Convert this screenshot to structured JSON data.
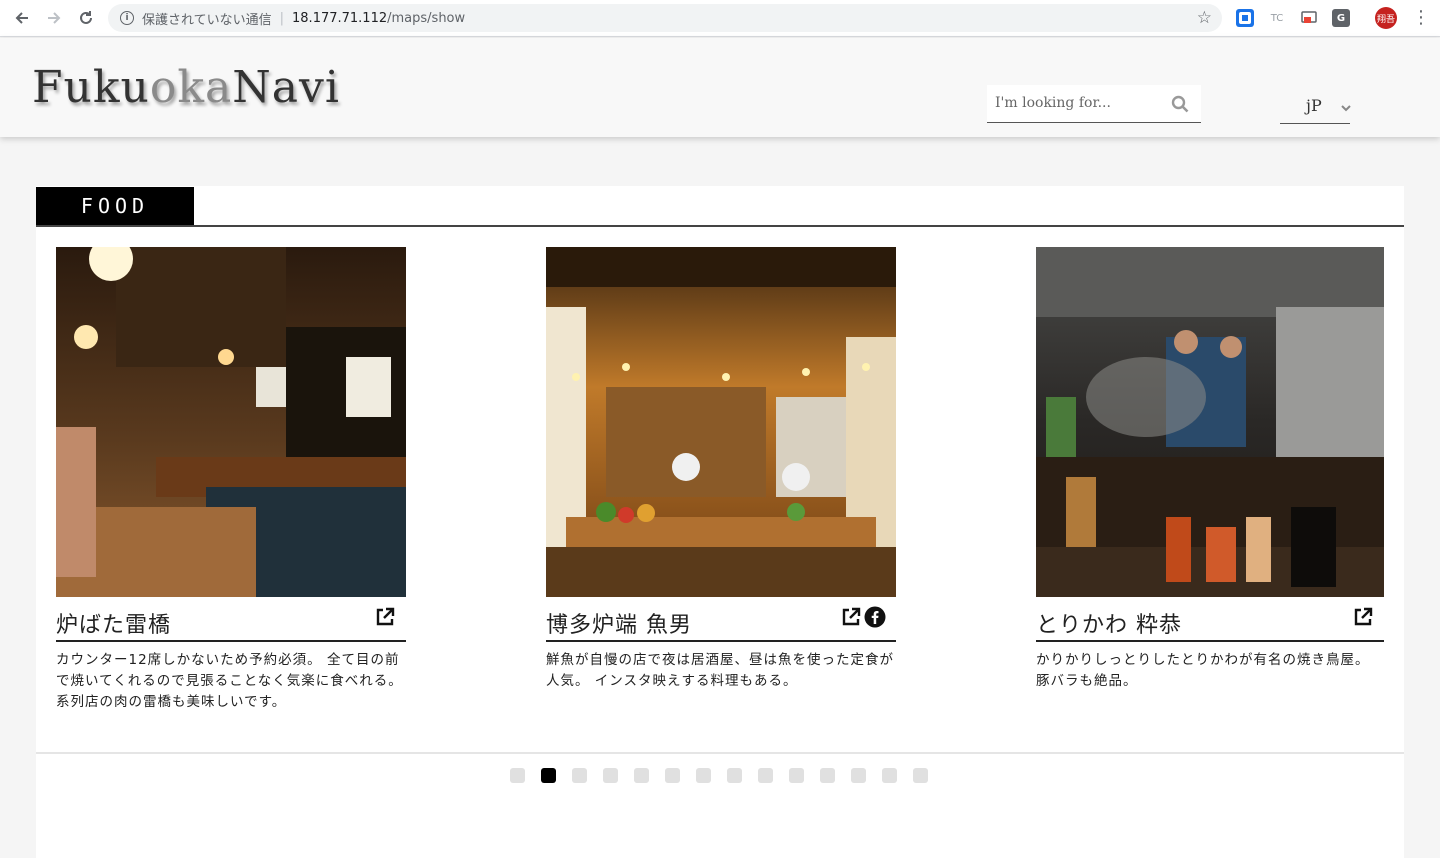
{
  "browser": {
    "insecure_label": "保護されていない通信",
    "url_host": "18.177.71.112",
    "url_path": "/maps/show",
    "extensions": [
      "TC",
      "G"
    ],
    "profile_label": "翔吾"
  },
  "header": {
    "logo_part1": "Fuku",
    "logo_part2": "oka",
    "logo_part3": "Navi",
    "search_placeholder": "I'm looking for...",
    "language": "jP"
  },
  "section": {
    "title": "FOOD"
  },
  "cards": [
    {
      "title": "炉ばた雷橋",
      "description": "カウンター12席しかないため予約必須。 全て目の前で焼いてくれるので見張ることなく気楽に食べれる。 系列店の肉の雷橋も美味しいです。",
      "icons": [
        "external-link-icon"
      ]
    },
    {
      "title": "博多炉端 魚男",
      "description": "鮮魚が自慢の店で夜は居酒屋、昼は魚を使った定食が人気。 インスタ映えする料理もある。",
      "icons": [
        "external-link-icon",
        "facebook-icon"
      ]
    },
    {
      "title": "とりかわ 粋恭",
      "description": "かりかりしっとりしたとりかわが有名の焼き鳥屋。 豚バラも絶品。",
      "icons": [
        "external-link-icon"
      ]
    }
  ],
  "pagination": {
    "total": 14,
    "active_index": 1
  }
}
